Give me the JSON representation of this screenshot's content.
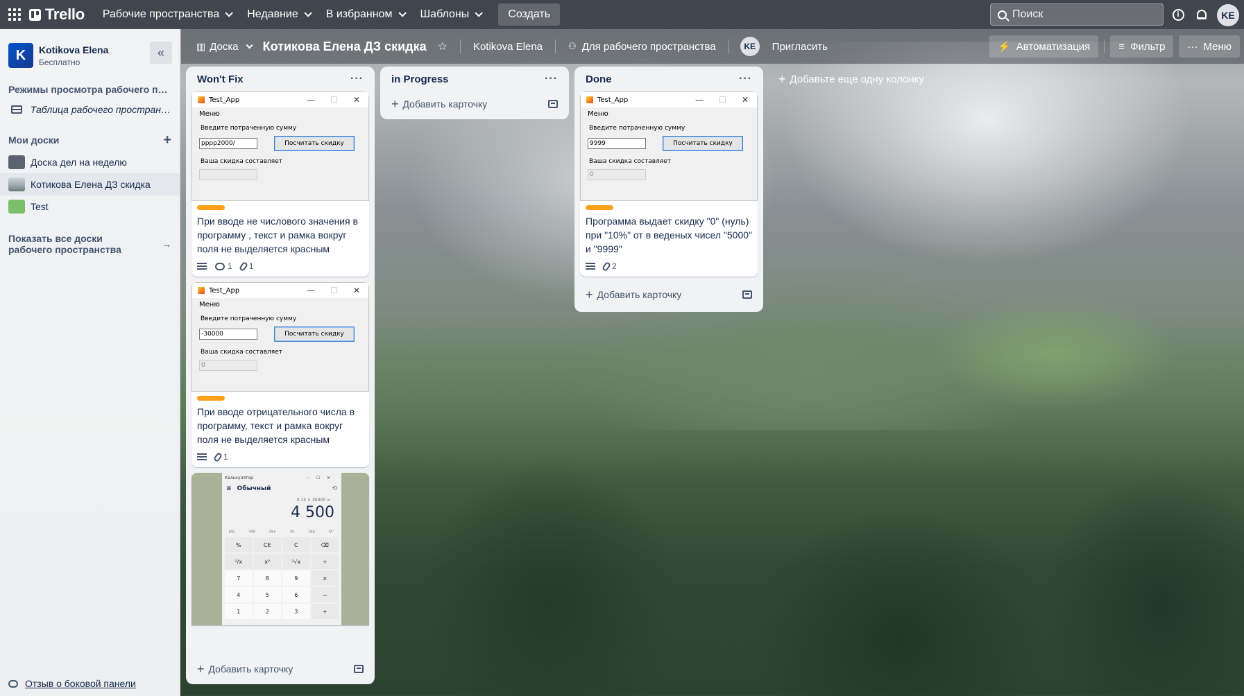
{
  "topbar": {
    "logo": "Trello",
    "nav": [
      "Рабочие пространства",
      "Недавние",
      "В избранном",
      "Шаблоны"
    ],
    "create": "Создать",
    "search_placeholder": "Поиск",
    "avatar": "KE"
  },
  "sidebar": {
    "workspace_name": "Kotikova Elena",
    "workspace_letter": "K",
    "workspace_plan": "Бесплатно",
    "views_heading": "Режимы просмотра рабочего пр...",
    "views_item": "Таблица рабочего пространст...",
    "boards_heading": "Мои доски",
    "boards": [
      {
        "label": "Доска дел на неделю",
        "color": "#5a6470"
      },
      {
        "label": "Котикова Елена ДЗ скидка",
        "color": "#9aa6b0"
      },
      {
        "label": "Test",
        "color": "#7bbf6a"
      }
    ],
    "show_all": "Показать все доски рабочего пространства",
    "feedback": "Отзыв о боковой панели"
  },
  "board": {
    "view": "Доска",
    "title": "Котикова Елена ДЗ скидка",
    "workspace": "Kotikova Elena",
    "visibility": "Для рабочего пространства",
    "member": "KE",
    "invite": "Пригласить",
    "automation": "Автоматизация",
    "filter": "Фильтр",
    "menu": "Меню",
    "add_list": "Добавьте еще одну колонку",
    "add_card": "Добавить карточку"
  },
  "lists": [
    {
      "title": "Won't Fix",
      "cards": [
        {
          "title": "При вводе не числового значения в программу , текст и рамка вокруг поля не выделяется красным",
          "comments": "1",
          "attachments": "1",
          "shot": {
            "app": "Test_App",
            "menu": "Меню",
            "prompt": "Введите потраченную сумму",
            "input": "pppp2000/",
            "button": "Посчитать скидку",
            "result_label": "Ваша скидка составляет",
            "result": ""
          }
        },
        {
          "title": "При вводе отрицательного числа в программу, текст и рамка вокруг поля не выделяется красным",
          "attachments": "1",
          "shot": {
            "app": "Test_App",
            "menu": "Меню",
            "prompt": "Введите потраченную сумму",
            "input": "-30000",
            "button": "Посчитать скидку",
            "result_label": "Ваша скидка составляет",
            "result": "0"
          }
        }
      ],
      "calc": {
        "app": "Калькулятор",
        "mode": "Обычный",
        "expr": "0,15 × 30000 =",
        "result": "4 500",
        "mem": [
          "MC",
          "MR",
          "M+",
          "M-",
          "MS",
          "M˅"
        ],
        "keys": [
          "%",
          "CE",
          "C",
          "⌫",
          "¹/x",
          "x²",
          "²√x",
          "÷",
          "7",
          "8",
          "9",
          "×",
          "4",
          "5",
          "6",
          "−",
          "1",
          "2",
          "3",
          "+"
        ]
      }
    },
    {
      "title": "in Progress",
      "cards": []
    },
    {
      "title": "Done",
      "cards": [
        {
          "title": "Программа выдает скидку \"0\" (нуль) при \"10%\" от в веденых чисел \"5000\" и \"9999\"",
          "attachments": "2",
          "shot": {
            "app": "Test_App",
            "menu": "Меню",
            "prompt": "Введите потраченную сумму",
            "input": "9999",
            "button": "Посчитать скидку",
            "result_label": "Ваша скидка составляет",
            "result": "0"
          }
        }
      ]
    }
  ],
  "colors": {
    "label_orange": "#ff9f1a",
    "workspace_badge": "#0052cc"
  }
}
